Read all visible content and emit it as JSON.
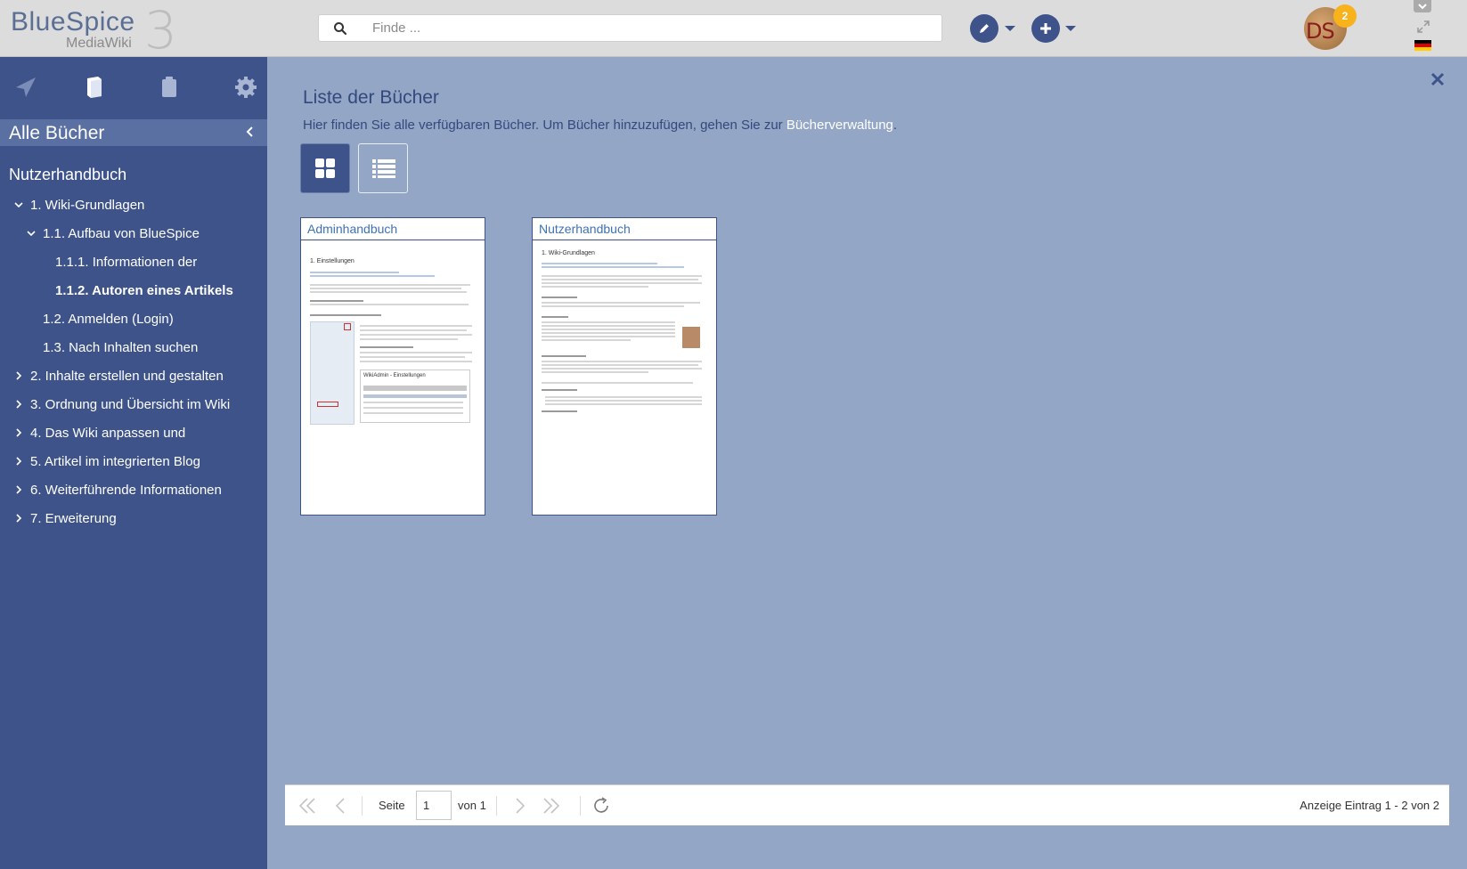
{
  "logo": {
    "brand": "BlueSpice",
    "sub": "MediaWiki",
    "version": "3"
  },
  "search": {
    "placeholder": "Finde ..."
  },
  "user": {
    "initials": "DS",
    "notifications": "2"
  },
  "sidebar": {
    "header": "Alle Bücher",
    "book_title": "Nutzerhandbuch",
    "items": [
      {
        "label": "1. Wiki-Grundlagen"
      },
      {
        "label": "1.1. Aufbau von BlueSpice"
      },
      {
        "label": "1.1.1. Informationen der"
      },
      {
        "label": "1.1.2. Autoren eines Artikels"
      },
      {
        "label": "1.2. Anmelden (Login)"
      },
      {
        "label": "1.3. Nach Inhalten suchen"
      },
      {
        "label": "2. Inhalte erstellen und gestalten"
      },
      {
        "label": "3. Ordnung und Übersicht im Wiki"
      },
      {
        "label": "4. Das Wiki anpassen und"
      },
      {
        "label": "5. Artikel im integrierten Blog"
      },
      {
        "label": "6. Weiterführende Informationen"
      },
      {
        "label": "7. Erweiterung"
      }
    ]
  },
  "main": {
    "title": "Liste der Bücher",
    "description_prefix": "Hier finden Sie alle verfügbaren Bücher. Um Bücher hinzuzufügen, gehen Sie zur ",
    "description_link": "Bücherverwaltung",
    "description_suffix": ".",
    "books": [
      {
        "title": "Adminhandbuch",
        "thumb_heading": "1. Einstellungen",
        "thumb_section": "WikiAdmin - Einstellungen"
      },
      {
        "title": "Nutzerhandbuch",
        "thumb_heading": "1. Wiki-Grundlagen"
      }
    ]
  },
  "pager": {
    "page_label": "Seite",
    "page_value": "1",
    "of_label": "von 1",
    "info": "Anzeige Eintrag 1 - 2 von 2"
  },
  "colors": {
    "sidebar": "#3e5389",
    "content": "#93a6c6",
    "badge": "#f7b21c",
    "link": "#3e71b5"
  }
}
